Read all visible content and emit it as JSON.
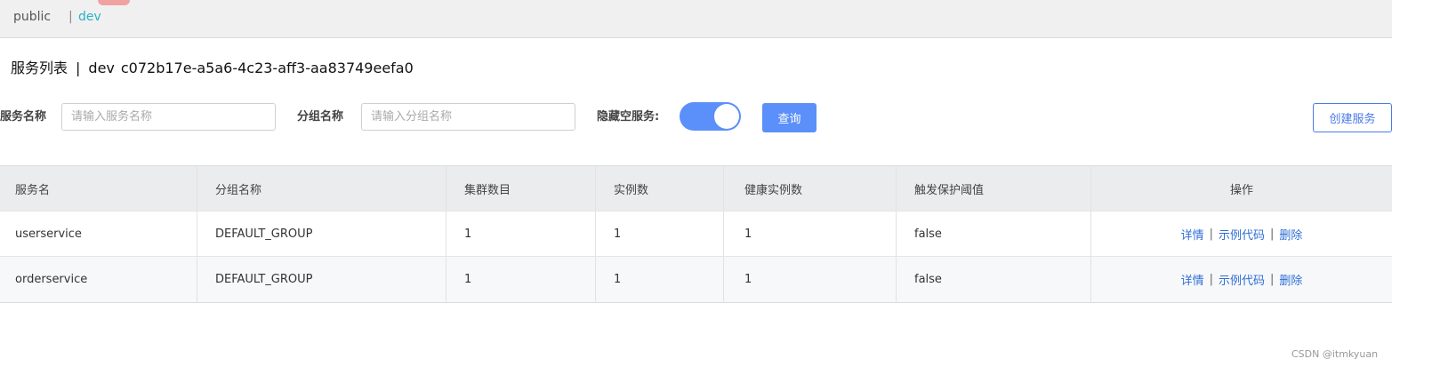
{
  "namespaces": {
    "public": "public",
    "separator": "|",
    "active": "dev"
  },
  "title": {
    "text": "服务列表",
    "separator": "|",
    "namespace_name": "dev",
    "namespace_id": "c072b17e-a5a6-4c23-aff3-aa83749eefa0"
  },
  "filters": {
    "service_label": "服务名称",
    "service_placeholder": "请输入服务名称",
    "group_label": "分组名称",
    "group_placeholder": "请输入分组名称",
    "hide_empty_label": "隐藏空服务:",
    "hide_empty_on": true,
    "query_button": "查询",
    "create_button": "创建服务"
  },
  "table": {
    "columns": [
      "服务名",
      "分组名称",
      "集群数目",
      "实例数",
      "健康实例数",
      "触发保护阈值",
      "操作"
    ],
    "rows": [
      {
        "service": "userservice",
        "group": "DEFAULT_GROUP",
        "clusters": "1",
        "instances": "1",
        "healthy": "1",
        "protect": "false"
      },
      {
        "service": "orderservice",
        "group": "DEFAULT_GROUP",
        "clusters": "1",
        "instances": "1",
        "healthy": "1",
        "protect": "false"
      }
    ],
    "actions": {
      "detail": "详情",
      "sample_code": "示例代码",
      "delete": "删除",
      "separator": "|"
    }
  },
  "watermark": "CSDN @itmkyuan",
  "colors": {
    "accent": "#5b8ff9",
    "link": "#2f6ed6",
    "namespace_active": "#28b3c7"
  }
}
